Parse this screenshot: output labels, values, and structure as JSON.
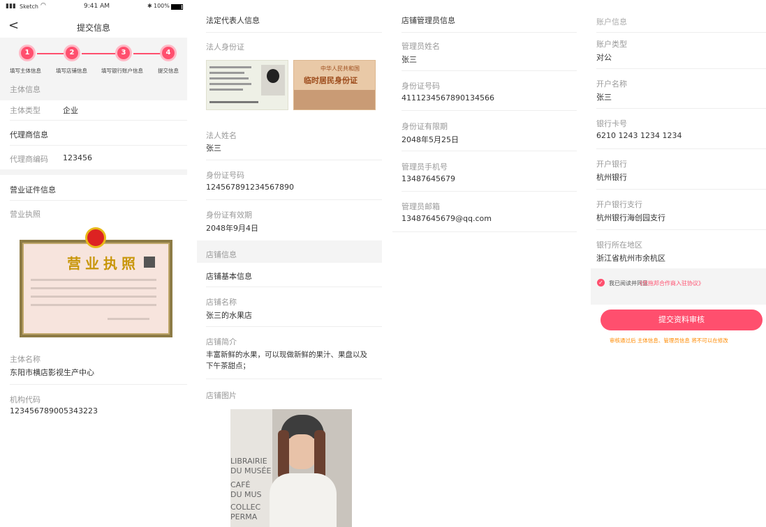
{
  "status_bar": {
    "carrier": "Sketch",
    "time": "9:41 AM",
    "battery": "100%"
  },
  "nav": {
    "title": "提交信息"
  },
  "steps": [
    {
      "num": "1",
      "label": "填写主体信息"
    },
    {
      "num": "2",
      "label": "填写店铺信息"
    },
    {
      "num": "3",
      "label": "填写银行账户信息"
    },
    {
      "num": "4",
      "label": "提交信息"
    }
  ],
  "col1": {
    "subject_section": "主体信息",
    "subject_type_label": "主体类型",
    "subject_type_value": "企业",
    "agent_section": "代理商信息",
    "agent_code_label": "代理商编码",
    "agent_code_value": "123456",
    "license_section": "营业证件信息",
    "license_label": "营业执照",
    "license_title": "营业执照",
    "subject_name_label": "主体名称",
    "subject_name_value": "东阳市横店影视生产中心",
    "org_code_label": "机构代码",
    "org_code_value": "123456789005343223"
  },
  "col2": {
    "legal_section": "法定代表人信息",
    "id_card_label": "法人身份证",
    "id_card_back_title_1": "中华人民共和国",
    "id_card_back_title_2": "临时居民身份证",
    "legal_name_label": "法人姓名",
    "legal_name_value": "张三",
    "id_number_label": "身份证号码",
    "id_number_value": "124567891234567890",
    "id_valid_label": "身份证有效期",
    "id_valid_value": "2048年9月4日",
    "shop_section": "店铺信息",
    "shop_basic_label": "店铺基本信息",
    "shop_name_label": "店铺名称",
    "shop_name_value": "张三的水果店",
    "shop_intro_label": "店铺简介",
    "shop_intro_line1": "丰富新鲜的水果，可以现做新鲜的果汁、果盘以及",
    "shop_intro_line2": "下午茶甜点；",
    "shop_images_label": "店铺图片",
    "photo_text_1": "LIBRAIRIE",
    "photo_text_2": "DU MUSÉE",
    "photo_text_3": "CAFÉ",
    "photo_text_4": "DU MUS",
    "photo_text_5": "COLLEC",
    "photo_text_6": "PERMA"
  },
  "col3": {
    "admin_section": "店铺管理员信息",
    "admin_name_label": "管理员姓名",
    "admin_name_value": "张三",
    "admin_id_label": "身份证号码",
    "admin_id_value": "4111234567890134566",
    "admin_id_valid_label": "身份证有限期",
    "admin_id_valid_value": "2048年5月25日",
    "admin_phone_label": "管理员手机号",
    "admin_phone_value": "13487645679",
    "admin_email_label": "管理员邮箱",
    "admin_email_value": "13487645679@qq.com"
  },
  "col4": {
    "account_section": "账户信息",
    "account_type_label": "账户类型",
    "account_type_value": "对公",
    "account_name_label": "开户名称",
    "account_name_value": "张三",
    "bank_card_label": "银行卡号",
    "bank_card_value": "6210 1243 1234 1234",
    "bank_label": "开户银行",
    "bank_value": "杭州银行",
    "branch_label": "开户银行支行",
    "branch_value": "杭州银行海创园支行",
    "region_label": "银行所在地区",
    "region_value": "浙江省杭州市余杭区",
    "agree_prefix": "我已阅读并同意",
    "agree_link": "《优拖邦合作商入驻协议》",
    "submit_label": "提交资料审核",
    "notice": "审核通过后 主体信息、管理员信息 将不可以在修改"
  },
  "colors": {
    "accent": "#ff4f6e",
    "notice": "#ff8a00",
    "bg_gray": "#f4f4f4"
  }
}
